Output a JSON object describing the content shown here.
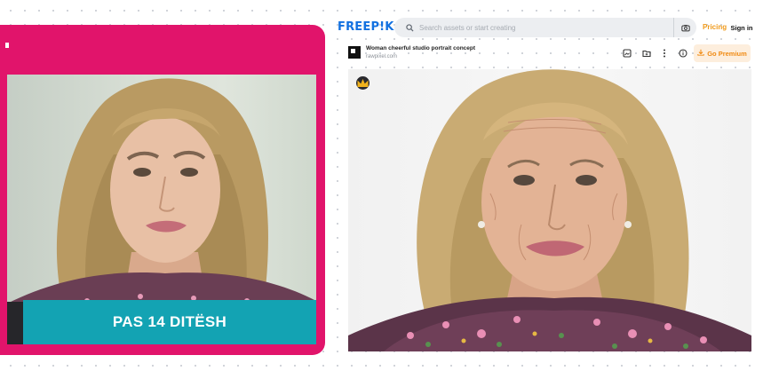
{
  "left": {
    "banner_text": "PAS 14 DITËSH"
  },
  "freepik": {
    "logo": "FREEP!K",
    "search_placeholder": "Search assets or start creating",
    "pricing": "Pricing",
    "sign_in": "Sign in",
    "asset_title": "Woman cheerful studio portrait concept",
    "asset_source": "rawpixel.com",
    "go_premium": "Go Premium"
  },
  "colors": {
    "magenta_frame": "#e1146b",
    "teal_banner": "#13a3b3",
    "freepik_blue": "#1371e0",
    "premium_orange": "#f09a1b"
  },
  "icons": [
    "search-icon",
    "camera-icon",
    "image-save-icon",
    "folder-add-icon",
    "more-vertical-icon",
    "info-icon",
    "download-icon",
    "crown-icon"
  ]
}
